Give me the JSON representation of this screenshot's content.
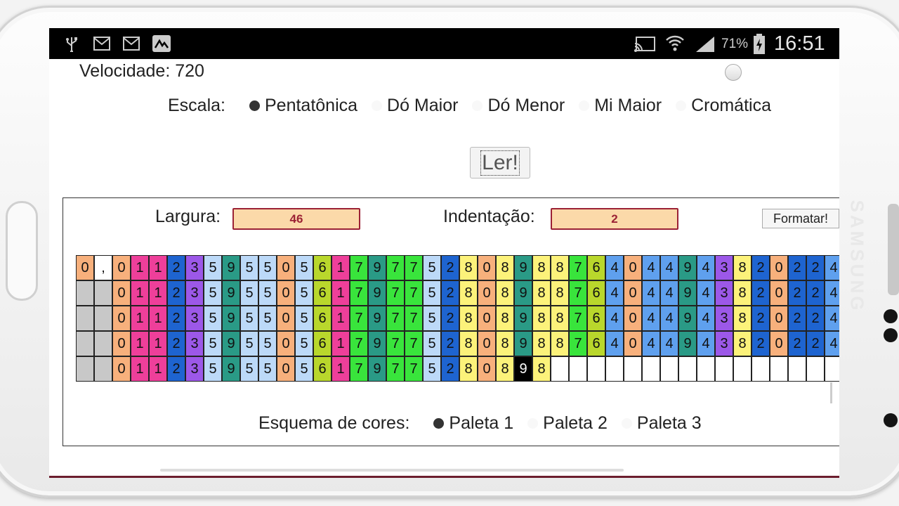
{
  "status_bar": {
    "battery": "71%",
    "time": "16:51"
  },
  "speed_label": "Velocidade: 720",
  "scale": {
    "label": "Escala:",
    "options": [
      "Pentatônica",
      "Dó Maior",
      "Dó Menor",
      "Mi Maior",
      "Cromática"
    ],
    "selected": 0
  },
  "read_button": "Ler!",
  "width": {
    "label": "Largura:",
    "value": "46"
  },
  "indent": {
    "label": "Indentação:",
    "value": "2"
  },
  "format_button": "Formatar!",
  "sequence": {
    "header_row": [
      "0",
      ","
    ],
    "digits": [
      "0",
      "1",
      "1",
      "2",
      "3",
      "5",
      "9",
      "5",
      "5",
      "0",
      "5",
      "6",
      "1",
      "7",
      "9",
      "7",
      "7",
      "5",
      "2",
      "8",
      "0",
      "8",
      "9",
      "8",
      "8",
      "7",
      "6",
      "4",
      "0",
      "4",
      "4",
      "9",
      "4",
      "3",
      "8",
      "2",
      "0",
      "2",
      "2",
      "4"
    ],
    "rows": 5,
    "last_row_length": 24,
    "cursor_index": 22
  },
  "digit_colors": {
    "0": "#f7b07c",
    "1": "#ee3f9a",
    "2": "#1e64d0",
    "3": "#9c58e8",
    "4": "#5fa0ee",
    "5": "#bcd9f8",
    "6": "#b9d72c",
    "7": "#39e43c",
    "8": "#fcf27a",
    "9": "#2a9a86"
  },
  "palette": {
    "label": "Esquema de cores:",
    "options": [
      "Paleta 1",
      "Paleta 2",
      "Paleta 3"
    ],
    "selected": 0
  }
}
